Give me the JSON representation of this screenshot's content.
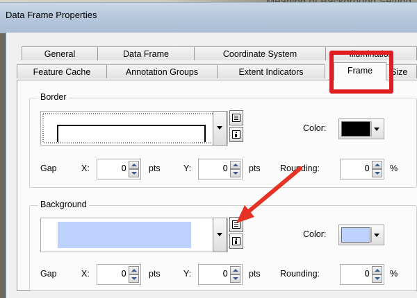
{
  "background_hint": "Meaning of Background Setting",
  "window": {
    "title": "Data Frame Properties"
  },
  "tabs_row1": [
    {
      "label": "General"
    },
    {
      "label": "Data Frame"
    },
    {
      "label": "Coordinate System"
    },
    {
      "label": "Illumination"
    }
  ],
  "tabs_row2": [
    {
      "label": "Feature Cache"
    },
    {
      "label": "Annotation Groups"
    },
    {
      "label": "Extent Indicators"
    },
    {
      "label": "Frame"
    },
    {
      "label": "Size"
    }
  ],
  "border": {
    "legend": "Border",
    "color_label": "Color:",
    "color": "#000000",
    "gap_label": "Gap",
    "x_label": "X:",
    "x_value": "0",
    "x_unit": "pts",
    "y_label": "Y:",
    "y_value": "0",
    "y_unit": "pts",
    "rounding_label": "Rounding:",
    "rounding_value": "0",
    "rounding_unit": "%"
  },
  "background": {
    "legend": "Background",
    "color_label": "Color:",
    "color": "#bed2ff",
    "gap_label": "Gap",
    "x_label": "X:",
    "x_value": "0",
    "x_unit": "pts",
    "y_label": "Y:",
    "y_value": "0",
    "y_unit": "pts",
    "rounding_label": "Rounding:",
    "rounding_value": "0",
    "rounding_unit": "%"
  },
  "annotation": {
    "highlight_color": "#e11d24",
    "arrow_color": "#e53224"
  }
}
